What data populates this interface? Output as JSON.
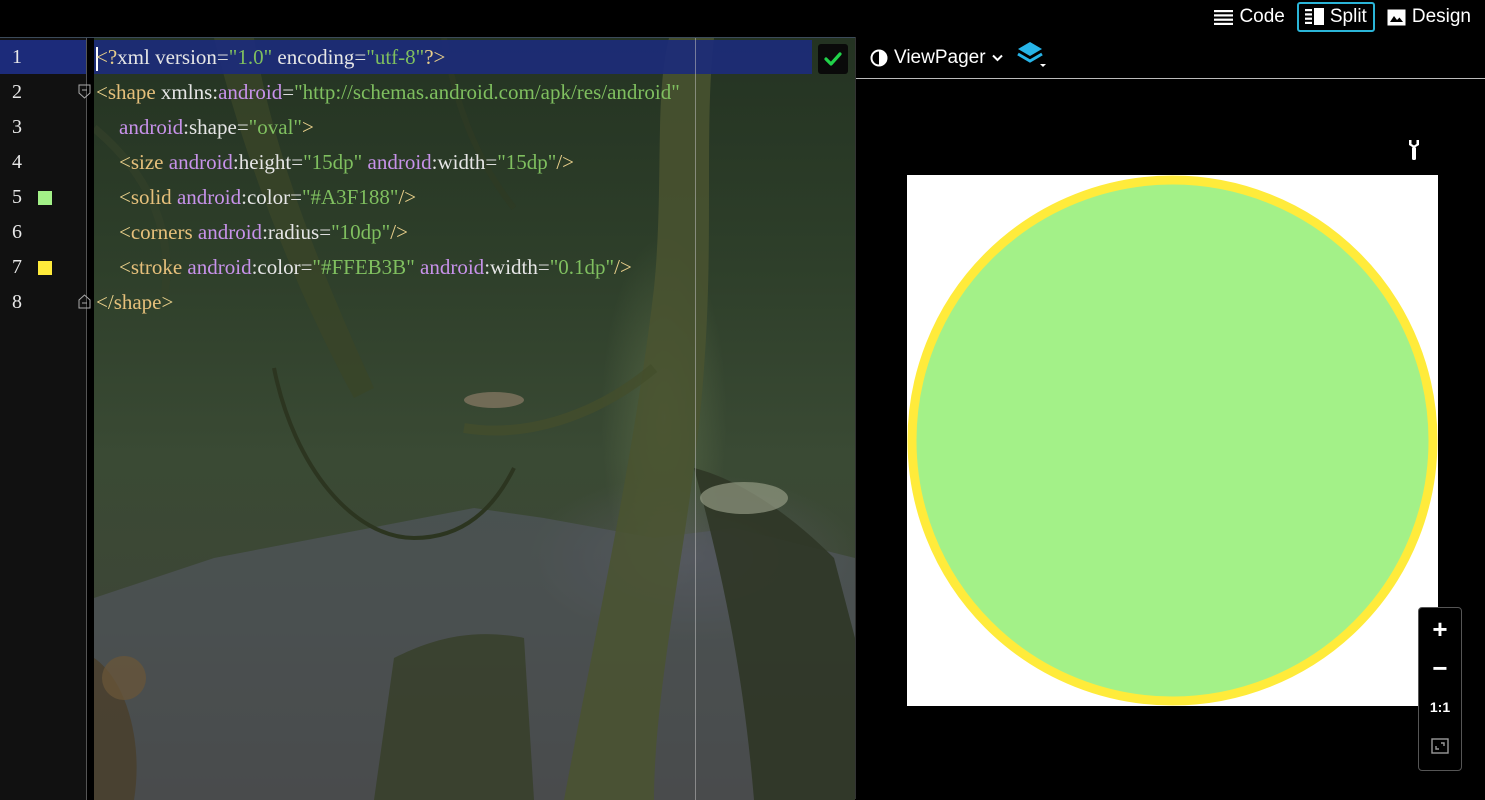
{
  "modes": [
    {
      "label": "Code",
      "icon": "list-icon",
      "active": false
    },
    {
      "label": "Split",
      "icon": "split-icon",
      "active": true
    },
    {
      "label": "Design",
      "icon": "image-icon",
      "active": false
    }
  ],
  "editor": {
    "lines": [
      {
        "n": "1",
        "tokens": [
          [
            "br",
            "<?"
          ],
          [
            "plain",
            "xml version"
          ],
          [
            "eq",
            "="
          ],
          [
            "str",
            "\"1.0\""
          ],
          [
            "plain",
            " encoding"
          ],
          [
            "eq",
            "="
          ],
          [
            "str",
            "\"utf-8\""
          ],
          [
            "br",
            "?>"
          ]
        ]
      },
      {
        "n": "2",
        "tokens": [
          [
            "br",
            "<"
          ],
          [
            "tag",
            "shape"
          ],
          [
            "plain",
            " xmlns"
          ],
          [
            "eq",
            ":"
          ],
          [
            "ns",
            "android"
          ],
          [
            "eq",
            "="
          ],
          [
            "str",
            "\"http://schemas.android.com/apk/res/android\""
          ]
        ]
      },
      {
        "n": "3",
        "tokens": [
          [
            "ns",
            "android"
          ],
          [
            "eq",
            ":"
          ],
          [
            "plain",
            "shape"
          ],
          [
            "eq",
            "="
          ],
          [
            "str",
            "\"oval\""
          ],
          [
            "br",
            ">"
          ]
        ]
      },
      {
        "n": "4",
        "tokens": [
          [
            "br",
            "<"
          ],
          [
            "tag",
            "size"
          ],
          [
            "ns",
            " android"
          ],
          [
            "eq",
            ":"
          ],
          [
            "plain",
            "height"
          ],
          [
            "eq",
            "="
          ],
          [
            "str",
            "\"15dp\""
          ],
          [
            "ns",
            " android"
          ],
          [
            "eq",
            ":"
          ],
          [
            "plain",
            "width"
          ],
          [
            "eq",
            "="
          ],
          [
            "str",
            "\"15dp\""
          ],
          [
            "br",
            "/>"
          ]
        ]
      },
      {
        "n": "5",
        "tokens": [
          [
            "br",
            "<"
          ],
          [
            "tag",
            "solid"
          ],
          [
            "ns",
            " android"
          ],
          [
            "eq",
            ":"
          ],
          [
            "plain",
            "color"
          ],
          [
            "eq",
            "="
          ],
          [
            "str",
            "\"#A3F188\""
          ],
          [
            "br",
            "/>"
          ]
        ]
      },
      {
        "n": "6",
        "tokens": [
          [
            "br",
            "<"
          ],
          [
            "tag",
            "corners"
          ],
          [
            "ns",
            " android"
          ],
          [
            "eq",
            ":"
          ],
          [
            "plain",
            "radius"
          ],
          [
            "eq",
            "="
          ],
          [
            "str",
            "\"10dp\""
          ],
          [
            "br",
            "/>"
          ]
        ]
      },
      {
        "n": "7",
        "tokens": [
          [
            "br",
            "<"
          ],
          [
            "tag",
            "stroke"
          ],
          [
            "ns",
            " android"
          ],
          [
            "eq",
            ":"
          ],
          [
            "plain",
            "color"
          ],
          [
            "eq",
            "="
          ],
          [
            "str",
            "\"#FFEB3B\""
          ],
          [
            "ns",
            " android"
          ],
          [
            "eq",
            ":"
          ],
          [
            "plain",
            "width"
          ],
          [
            "eq",
            "="
          ],
          [
            "str",
            "\"0.1dp\""
          ],
          [
            "br",
            "/>"
          ]
        ]
      },
      {
        "n": "8",
        "tokens": [
          [
            "br",
            "</"
          ],
          [
            "tag",
            "shape"
          ],
          [
            "br",
            ">"
          ]
        ]
      }
    ],
    "swatches": {
      "5": "#A3F188",
      "7": "#FFEB3B"
    }
  },
  "preview": {
    "selector_label": "ViewPager",
    "shape_fill": "#A3F188",
    "shape_stroke": "#FFEB3B",
    "zoom_buttons": [
      "+",
      "−",
      "1:1",
      ""
    ]
  }
}
